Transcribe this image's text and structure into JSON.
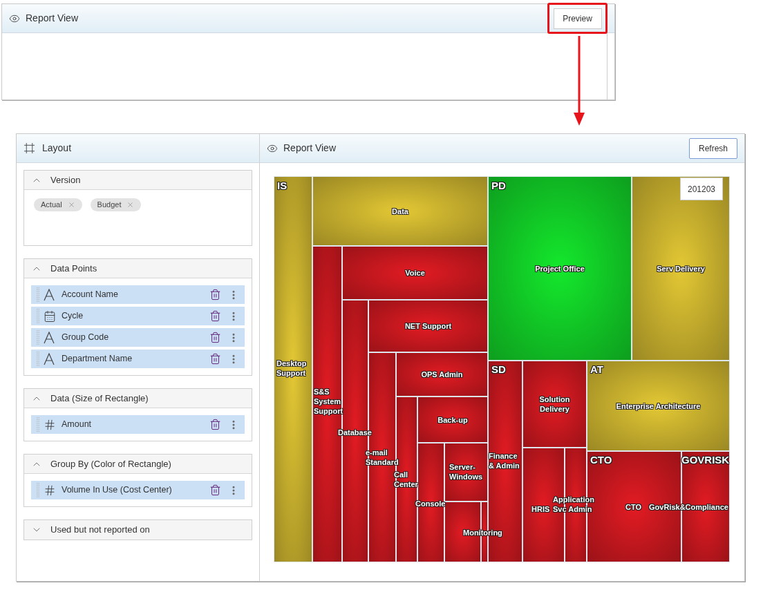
{
  "top_panel": {
    "title": "Report View",
    "preview_button": "Preview",
    "highlighted": true
  },
  "layout_panel": {
    "title": "Layout",
    "sections": [
      {
        "title": "Version",
        "expanded": true,
        "kind": "chips",
        "chips": [
          "Actual",
          "Budget"
        ]
      },
      {
        "title": "Data Points",
        "expanded": true,
        "kind": "fields",
        "fields": [
          {
            "label": "Account Name",
            "kind": "text"
          },
          {
            "label": "Cycle",
            "kind": "date"
          },
          {
            "label": "Group Code",
            "kind": "text"
          },
          {
            "label": "Department Name",
            "kind": "text"
          }
        ]
      },
      {
        "title": "Data (Size of Rectangle)",
        "expanded": true,
        "kind": "fields",
        "fields": [
          {
            "label": "Amount",
            "kind": "number"
          }
        ]
      },
      {
        "title": "Group By (Color of Rectangle)",
        "expanded": true,
        "kind": "fields",
        "fields": [
          {
            "label": "Volume In Use (Cost Center)",
            "kind": "number"
          }
        ]
      },
      {
        "title": "Used but not reported on",
        "expanded": false
      }
    ]
  },
  "report_panel": {
    "title": "Report View",
    "refresh_button": "Refresh",
    "treemap": {
      "period": "201203",
      "groups": [
        {
          "label": "IS",
          "tiles": [
            {
              "label": "Desktop Support",
              "color": "#e3c834"
            },
            {
              "label": "Data",
              "color": "#e3c834"
            },
            {
              "label": "S&S System Support",
              "color": "#e31b23"
            },
            {
              "label": "Voice",
              "color": "#e31b23"
            },
            {
              "label": "Database",
              "color": "#e31b23"
            },
            {
              "label": "NET Support",
              "color": "#e31b23"
            },
            {
              "label": "e-mail Standard",
              "color": "#e31b23"
            },
            {
              "label": "OPS Admin",
              "color": "#e31b23"
            },
            {
              "label": "Call Center",
              "color": "#e31b23"
            },
            {
              "label": "Back-up",
              "color": "#e31b23"
            },
            {
              "label": "Console",
              "color": "#e31b23"
            },
            {
              "label": "Server-Windows",
              "color": "#e31b23"
            },
            {
              "label": "Monitoring",
              "color": "#e31b23"
            },
            {
              "color": "#e31b23"
            }
          ]
        },
        {
          "label": "PD",
          "tiles": [
            {
              "label": "Project Office",
              "color": "#14e82c"
            },
            {
              "label": "Serv Delivery",
              "color": "#e3c834"
            }
          ]
        },
        {
          "label": "SD",
          "tiles": [
            {
              "label": "Finance & Admin",
              "color": "#e31b23"
            },
            {
              "label": "Solution Delivery",
              "color": "#e31b23"
            },
            {
              "label": "HRIS",
              "color": "#e31b23"
            },
            {
              "label": "Application Svc Admin",
              "color": "#e31b23"
            }
          ]
        },
        {
          "label": "AT",
          "tiles": [
            {
              "label": "Enterprise Architecture",
              "color": "#e3c834"
            }
          ]
        },
        {
          "label": "CTO",
          "tiles": [
            {
              "label": "CTO",
              "color": "#e31b23"
            }
          ]
        },
        {
          "label": "GOVRISK",
          "tiles": [
            {
              "label": "GovRisk&Compliance",
              "color": "#e31b23"
            }
          ]
        }
      ]
    }
  }
}
